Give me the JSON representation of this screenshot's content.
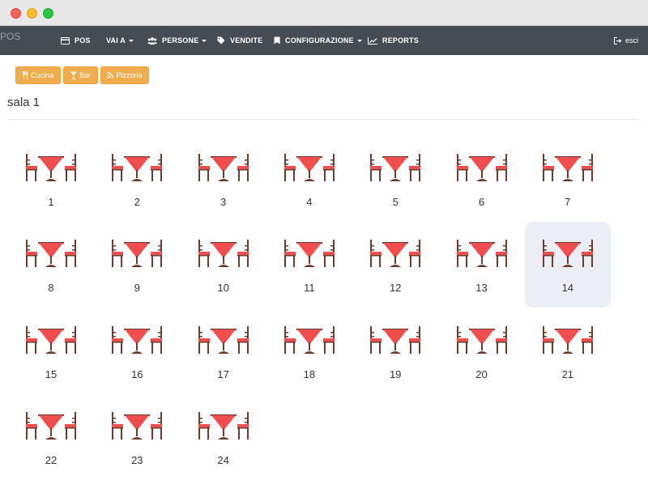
{
  "navbar": {
    "brand": "POS",
    "items": [
      {
        "label": "POS",
        "icon": "credit-card-icon",
        "dropdown": false
      },
      {
        "label": "VAI A",
        "icon": "",
        "dropdown": true
      },
      {
        "label": "PERSONE",
        "icon": "users-icon",
        "dropdown": true
      },
      {
        "label": "VENDITE",
        "icon": "tag-icon",
        "dropdown": false
      },
      {
        "label": "CONFIGURAZIONE",
        "icon": "bookmark-icon",
        "dropdown": true
      },
      {
        "label": "REPORTS",
        "icon": "line-chart-icon",
        "dropdown": false
      }
    ],
    "exit_label": "esci"
  },
  "filters": [
    {
      "label": "Cucina",
      "icon": "cutlery-icon"
    },
    {
      "label": "Bar",
      "icon": "cocktail-icon"
    },
    {
      "label": "Pizzeria",
      "icon": "rss-icon"
    }
  ],
  "room": {
    "title": "sala 1"
  },
  "tables": [
    "1",
    "2",
    "3",
    "4",
    "5",
    "6",
    "7",
    "8",
    "9",
    "10",
    "11",
    "12",
    "13",
    "14",
    "15",
    "16",
    "17",
    "18",
    "19",
    "20",
    "21",
    "22",
    "23",
    "24"
  ],
  "selected_table": "14",
  "colors": {
    "navbar": "#474b52",
    "button": "#f0ad4e",
    "table_top": "#f04e4e",
    "chair": "#6b3d2e",
    "selected_bg": "#eceef5"
  }
}
